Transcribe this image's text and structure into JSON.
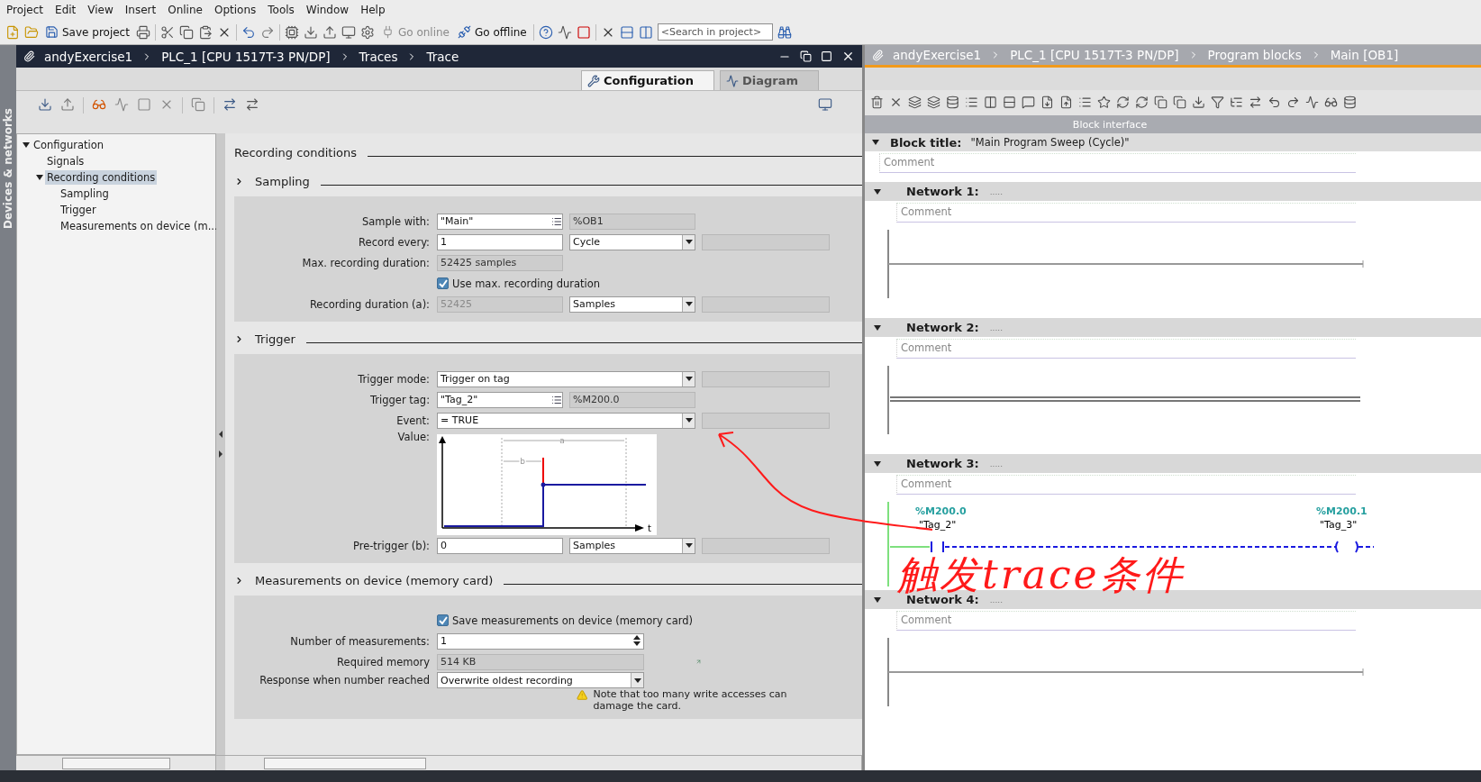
{
  "menu": [
    "Project",
    "Edit",
    "View",
    "Insert",
    "Online",
    "Options",
    "Tools",
    "Window",
    "Help"
  ],
  "toolbar": {
    "buttons": [
      {
        "label": "Save project",
        "disabled": false
      },
      {
        "label": "Go online",
        "disabled": true
      },
      {
        "label": "Go offline",
        "disabled": false
      }
    ],
    "search_placeholder": "<Search in project>"
  },
  "side_tab": "Devices & networks",
  "trace_editor": {
    "breadcrumb": [
      "andyExercise1",
      "PLC_1 [CPU 1517T-3 PN/DP]",
      "Traces",
      "Trace"
    ],
    "tabs": [
      {
        "label": "Configuration",
        "selected": true
      },
      {
        "label": "Diagram",
        "selected": false
      }
    ],
    "tree": [
      {
        "label": "Configuration",
        "expanded": true,
        "selected": false,
        "children": [
          {
            "label": "Signals",
            "selected": false
          },
          {
            "label": "Recording conditions",
            "expanded": true,
            "selected": true,
            "children": [
              {
                "label": "Sampling",
                "selected": false
              },
              {
                "label": "Trigger",
                "selected": false
              },
              {
                "label": "Measurements on device (m...",
                "selected": false
              }
            ]
          }
        ]
      }
    ],
    "heading": "Recording conditions",
    "sections": [
      {
        "title": "Sampling",
        "rows": [
          {
            "kind": "picker",
            "label": "Sample with:",
            "value": "\"Main\"",
            "extra": "%OB1"
          },
          {
            "kind": "entry",
            "label": "Record every:",
            "value": "1",
            "disabled": false,
            "option": "Cycle"
          },
          {
            "kind": "readonly",
            "label": "Max. recording duration:",
            "value": "52425 samples"
          },
          {
            "kind": "checkbox",
            "label": "Use max. recording duration",
            "checked": true
          },
          {
            "kind": "entry",
            "label": "Recording duration (a):",
            "value": "52425",
            "disabled": true,
            "option": "Samples"
          }
        ]
      },
      {
        "title": "Trigger",
        "rows": [
          {
            "kind": "select",
            "label": "Trigger mode:",
            "value": "Trigger on tag"
          },
          {
            "kind": "picker",
            "label": "Trigger tag:",
            "value": "\"Tag_2\"",
            "extra": "%M200.0"
          },
          {
            "kind": "select",
            "label": "Event:",
            "value": "= TRUE"
          },
          {
            "kind": "diagram",
            "label": "Value:",
            "span_a": "a",
            "span_b": "b",
            "axis": "t"
          },
          {
            "kind": "entry",
            "label": "Pre-trigger (b):",
            "value": "0",
            "disabled": false,
            "option": "Samples"
          }
        ]
      },
      {
        "title": "Measurements on device (memory card)",
        "rows": [
          {
            "kind": "checkbox",
            "label": "Save measurements on device (memory card)",
            "checked": true
          },
          {
            "kind": "spinner",
            "label": "Number of measurements:",
            "value": "1"
          },
          {
            "kind": "memory",
            "label": "Required memory",
            "value": "514 KB"
          },
          {
            "kind": "select_note",
            "label": "Response when number reached",
            "value": "Overwrite oldest recording",
            "note": "Note that too many write accesses can damage the card."
          }
        ]
      }
    ]
  },
  "block_editor": {
    "breadcrumb": [
      "andyExercise1",
      "PLC_1 [CPU 1517T-3 PN/DP]",
      "Program blocks",
      "Main [OB1]"
    ],
    "interface_label": "Block interface",
    "block_title": {
      "label": "Block title:",
      "value": "\"Main Program Sweep (Cycle)\"",
      "comment": "Comment"
    },
    "networks": [
      {
        "title": "Network 1:",
        "note": ".....",
        "comment": "Comment",
        "expanded": true,
        "kind": "empty"
      },
      {
        "title": "Network 2:",
        "note": ".....",
        "comment": "Comment",
        "expanded": true,
        "kind": "double"
      },
      {
        "title": "Network 3:",
        "note": ".....",
        "comment": "Comment",
        "expanded": true,
        "kind": "contact_coil",
        "contact_address": "%M200.0",
        "contact_tag": "\"Tag_2\"",
        "coil_address": "%M200.1",
        "coil_tag": "\"Tag_3\""
      },
      {
        "title": "Network 4:",
        "note": ".....",
        "comment": "Comment",
        "expanded": true,
        "kind": "empty"
      }
    ]
  },
  "annotation": {
    "text": "触发trace条件"
  }
}
